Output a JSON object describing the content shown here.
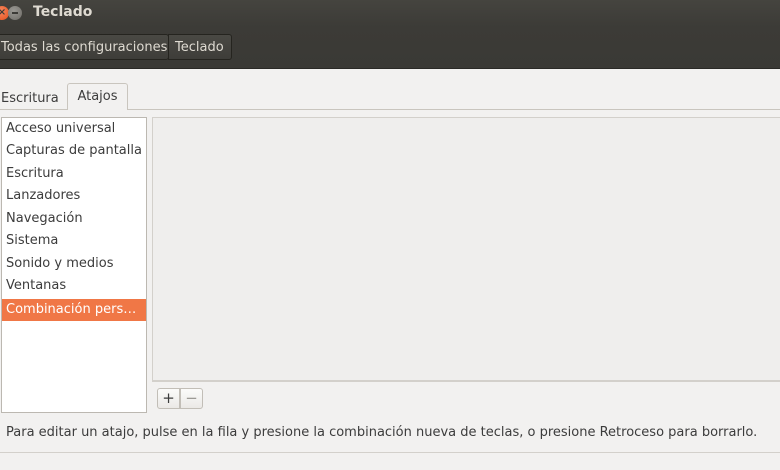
{
  "window": {
    "title": "Teclado",
    "close_glyph": "×"
  },
  "breadcrumbs": [
    {
      "label": "Todas las configuraciones"
    },
    {
      "label": "Teclado"
    }
  ],
  "tabs": [
    {
      "label": "Escritura",
      "active": false
    },
    {
      "label": "Atajos",
      "active": true
    }
  ],
  "categories": [
    {
      "label": "Acceso universal"
    },
    {
      "label": "Capturas de pantalla"
    },
    {
      "label": "Escritura"
    },
    {
      "label": "Lanzadores"
    },
    {
      "label": "Navegación"
    },
    {
      "label": "Sistema"
    },
    {
      "label": "Sonido y medios"
    },
    {
      "label": "Ventanas"
    },
    {
      "label": "Combinación pers…"
    }
  ],
  "selected_category_index": 8,
  "shortcut_buttons": {
    "add_label": "+",
    "remove_label": "−"
  },
  "help_text": "Para editar un atajo, pulse en la fila y presione la combinación nueva de teclas, o presione Retroceso para borrarlo.",
  "colors": {
    "accent": "#f07746",
    "titlebar": "#3c3b37",
    "close_button": "#e2501c"
  }
}
